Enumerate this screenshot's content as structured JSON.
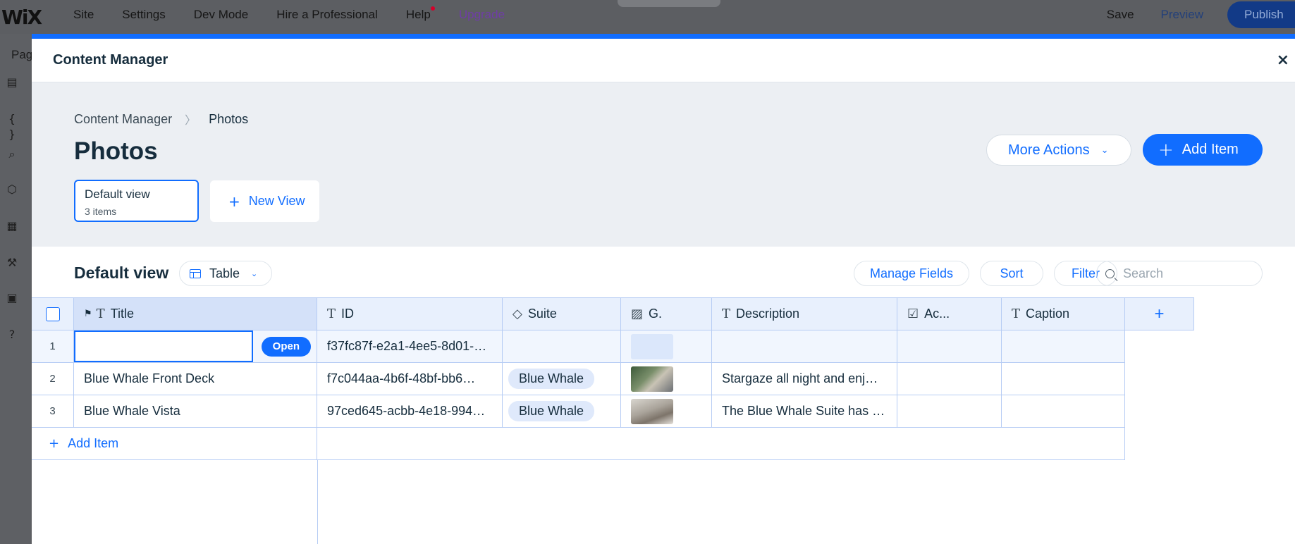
{
  "topbar": {
    "logo": "WiX",
    "menu": [
      "Site",
      "Settings",
      "Dev Mode",
      "Hire a Professional",
      "Help",
      "Upgrade"
    ],
    "save": "Save",
    "preview": "Preview",
    "publish": "Publish"
  },
  "rail": {
    "pages_label": "Pag",
    "icons": [
      "pages-icon",
      "code-icon",
      "search-icon",
      "cube-icon",
      "table-icon",
      "tools-icon",
      "apps-icon",
      "help-icon"
    ]
  },
  "modal": {
    "title": "Content Manager",
    "close": "×"
  },
  "breadcrumb": {
    "root": "Content Manager",
    "current": "Photos"
  },
  "page_title": "Photos",
  "actions": {
    "more_actions": "More Actions",
    "add_item": "Add Item"
  },
  "views": {
    "default_name": "Default view",
    "default_count": "3 items",
    "new_view": "New View"
  },
  "viewbar": {
    "title": "Default view",
    "layout": "Table",
    "manage_fields": "Manage Fields",
    "sort": "Sort",
    "filter": "Filter",
    "search_placeholder": "Search"
  },
  "table": {
    "columns": [
      "Title",
      "ID",
      "Suite",
      "G.",
      "Description",
      "Ac...",
      "Caption"
    ],
    "add_column": "+",
    "open_button": "Open",
    "rows": [
      {
        "num": "1",
        "title": "",
        "id": "f37fc87f-e2a1-4ee5-8d01-…",
        "suite": "",
        "description": "",
        "ac": "",
        "caption": ""
      },
      {
        "num": "2",
        "title": "Blue Whale Front Deck",
        "id": "f7c044aa-4b6f-48bf-bb6…",
        "suite": "Blue Whale",
        "description": "Stargaze all night and enj…",
        "ac": "",
        "caption": ""
      },
      {
        "num": "3",
        "title": "Blue Whale Vista",
        "id": "97ced645-acbb-4e18-994…",
        "suite": "Blue Whale",
        "description": "The Blue Whale Suite has …",
        "ac": "",
        "caption": ""
      }
    ],
    "add_item": "Add Item"
  },
  "colors": {
    "accent": "#116dff",
    "grid_line": "#b6ccf4",
    "header_bg": "#e8f0fd",
    "hero_bg": "#eceff3"
  }
}
